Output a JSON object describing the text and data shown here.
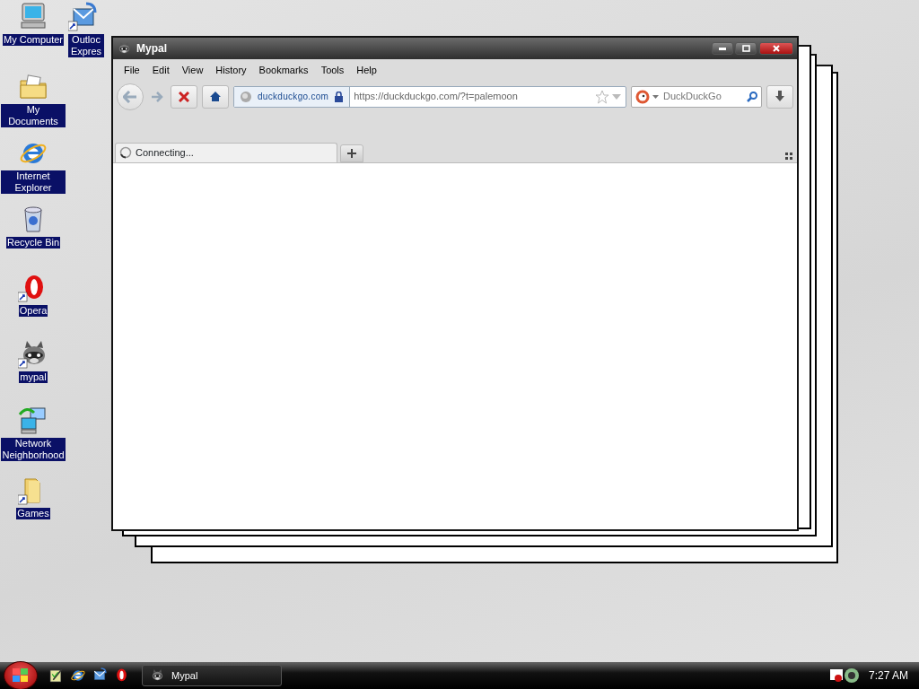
{
  "desktop_icons": [
    {
      "label": "My Computer",
      "kind": "computer",
      "shortcut": false
    },
    {
      "label": "My Documents",
      "kind": "folder-docs",
      "shortcut": false
    },
    {
      "label": "Internet Explorer",
      "kind": "ie",
      "shortcut": false
    },
    {
      "label": "Recycle Bin",
      "kind": "bin",
      "shortcut": false
    },
    {
      "label": "Opera",
      "kind": "opera",
      "shortcut": true
    },
    {
      "label": "mypal",
      "kind": "raccoon",
      "shortcut": true
    },
    {
      "label": "Network Neighborhood",
      "kind": "network",
      "shortcut": false
    },
    {
      "label": "Games",
      "kind": "folder",
      "shortcut": true
    },
    {
      "label": "Outloc Expres",
      "kind": "outlook",
      "shortcut": true
    }
  ],
  "window": {
    "title": "Mypal",
    "menu": [
      "File",
      "Edit",
      "View",
      "History",
      "Bookmarks",
      "Tools",
      "Help"
    ],
    "identity": "duckduckgo.com",
    "url": "https://duckduckgo.com/?t=palemoon",
    "search": {
      "placeholder": "DuckDuckGo"
    },
    "tabs": [
      {
        "label": "Connecting...",
        "selected": true,
        "loading": true
      }
    ]
  },
  "taskbar": {
    "quick_launch": [
      {
        "kind": "notepad"
      },
      {
        "kind": "ie"
      },
      {
        "kind": "outlook"
      },
      {
        "kind": "opera"
      }
    ],
    "tasks": [
      {
        "label": "Mypal",
        "selected": false
      }
    ],
    "clock": "7:27 AM"
  }
}
